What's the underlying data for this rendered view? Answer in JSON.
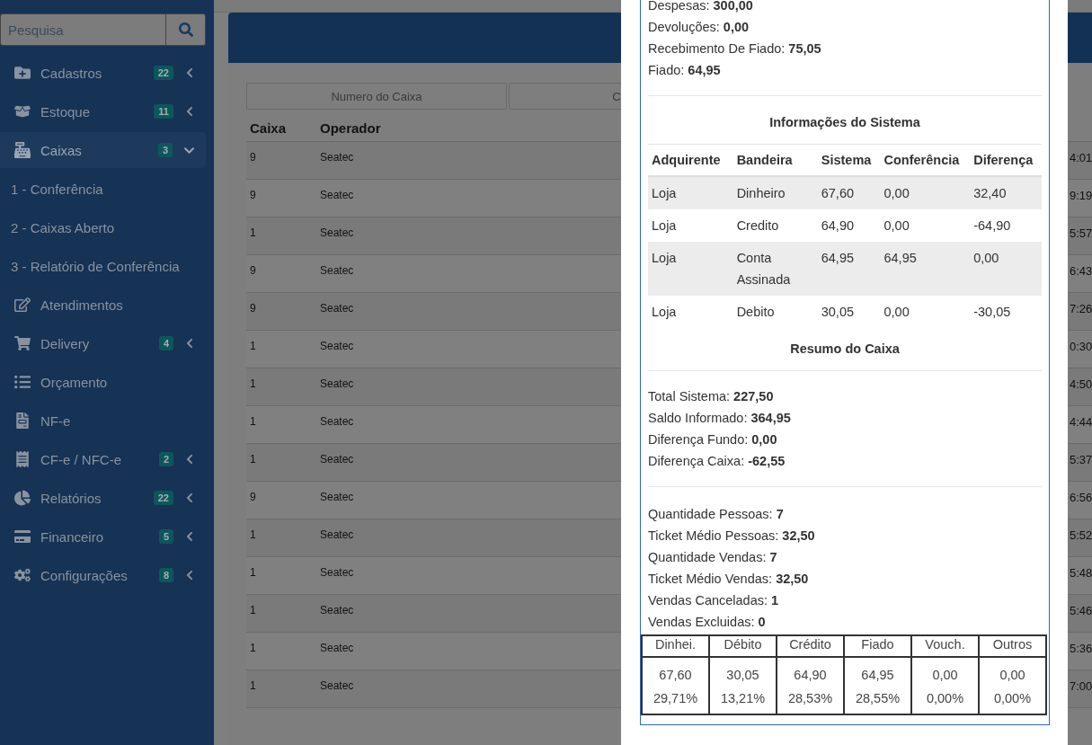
{
  "sidebar": {
    "search": {
      "placeholder": "Pesquisa"
    },
    "items": [
      {
        "label": "Cadastros",
        "badge": "22",
        "expanded": false,
        "selected": false
      },
      {
        "label": "Estoque",
        "badge": "11",
        "expanded": false,
        "selected": false
      },
      {
        "label": "Caixas",
        "badge": "3",
        "expanded": true,
        "selected": true,
        "children": [
          {
            "label": "1 - Conferência",
            "selected": false
          },
          {
            "label": "2 - Caixas Aberto",
            "selected": false
          },
          {
            "label": "3 - Relatório de Conferência",
            "selected": false
          }
        ]
      },
      {
        "label": "Atendimentos",
        "selected": false
      },
      {
        "label": "Delivery",
        "badge": "4",
        "expanded": false,
        "selected": false
      },
      {
        "label": "Orçamento",
        "selected": false
      },
      {
        "label": "NF-e",
        "selected": false
      },
      {
        "label": "CF-e / NFC-e",
        "badge": "2",
        "expanded": false,
        "selected": false
      },
      {
        "label": "Relatórios",
        "badge": "22",
        "expanded": false,
        "selected": false
      },
      {
        "label": "Financeiro",
        "badge": "5",
        "expanded": false,
        "selected": false
      },
      {
        "label": "Configurações",
        "badge": "8",
        "expanded": false,
        "selected": false
      }
    ]
  },
  "filters": [
    {
      "placeholder": "Numero do Caixa"
    },
    {
      "placeholder": "C"
    }
  ],
  "table": {
    "columns": [
      "Caixa",
      "Operador"
    ],
    "rows": [
      {
        "caixa": "9",
        "operador": "Seatec",
        "column_3": "4:01"
      },
      {
        "caixa": "9",
        "operador": "Seatec",
        "column_3": "9:19"
      },
      {
        "caixa": "1",
        "operador": "Seatec",
        "column_3": "5:57"
      },
      {
        "caixa": "9",
        "operador": "Seatec",
        "column_3": "6:43"
      },
      {
        "caixa": "9",
        "operador": "Seatec",
        "column_3": "7:26"
      },
      {
        "caixa": "1",
        "operador": "Seatec",
        "column_3": "0:30"
      },
      {
        "caixa": "1",
        "operador": "Seatec",
        "column_3": "4:50"
      },
      {
        "caixa": "1",
        "operador": "Seatec",
        "column_3": "4:44"
      },
      {
        "caixa": "1",
        "operador": "Seatec",
        "column_3": "5:37"
      },
      {
        "caixa": "9",
        "operador": "Seatec",
        "column_3": "6:56"
      },
      {
        "caixa": "1",
        "operador": "Seatec",
        "column_3": "5:52"
      },
      {
        "caixa": "1",
        "operador": "Seatec",
        "column_3": "5:48"
      },
      {
        "caixa": "1",
        "operador": "Seatec",
        "column_3": "5:46"
      },
      {
        "caixa": "1",
        "operador": "Seatec",
        "column_3": "5:36"
      },
      {
        "caixa": "1",
        "operador": "Seatec",
        "column_3": "7:00"
      }
    ]
  },
  "modal": {
    "top_lines": [
      "Despesas: **300,00**",
      "Devoluções: **0,00**",
      "Recebimento De Fiado: **75,05**",
      "Fiado: **64,95**"
    ],
    "system_title": "Informações do Sistema",
    "system_table": {
      "columns": [
        "Adquirente",
        "Bandeira",
        "Sistema",
        "Conferência",
        "Diferença"
      ],
      "rows": [
        [
          "Loja",
          "Dinheiro",
          "67,60",
          "0,00",
          "32,40"
        ],
        [
          "Loja",
          "Credito",
          "64,90",
          "0,00",
          "-64,90"
        ],
        [
          "Loja",
          "Conta Assinada",
          "64,95",
          "64,95",
          "0,00"
        ],
        [
          "Loja",
          "Debito",
          "30,05",
          "0,00",
          "-30,05"
        ]
      ]
    },
    "summary_title": "Resumo do Caixa",
    "summary_lines": [
      "Total Sistema: **227,50**",
      "Saldo Informado: **364,95**",
      "Diferença Fundo: **0,00**",
      "Diferença Caixa: **-62,55**"
    ],
    "stats_lines": [
      "Quantidade Pessoas: **7**",
      "Ticket Médio Pessoas: **32,50**",
      "Quantidade Vendas: **7**",
      "Ticket Médio Vendas: **32,50**",
      "Vendas Canceladas: **1**",
      "Vendas Excluidas: **0**"
    ],
    "payments": [
      {
        "label": "Dinhei.",
        "value": "67,60",
        "percent": "29,71%"
      },
      {
        "label": "Débito",
        "value": "30,05",
        "percent": "13,21%"
      },
      {
        "label": "Crédito",
        "value": "64,90",
        "percent": "28,53%"
      },
      {
        "label": "Fiado",
        "value": "64,95",
        "percent": "28,55%"
      },
      {
        "label": "Vouch.",
        "value": "0,00",
        "percent": "0,00%"
      },
      {
        "label": "Outros",
        "value": "0,00",
        "percent": "0,00%"
      }
    ]
  }
}
